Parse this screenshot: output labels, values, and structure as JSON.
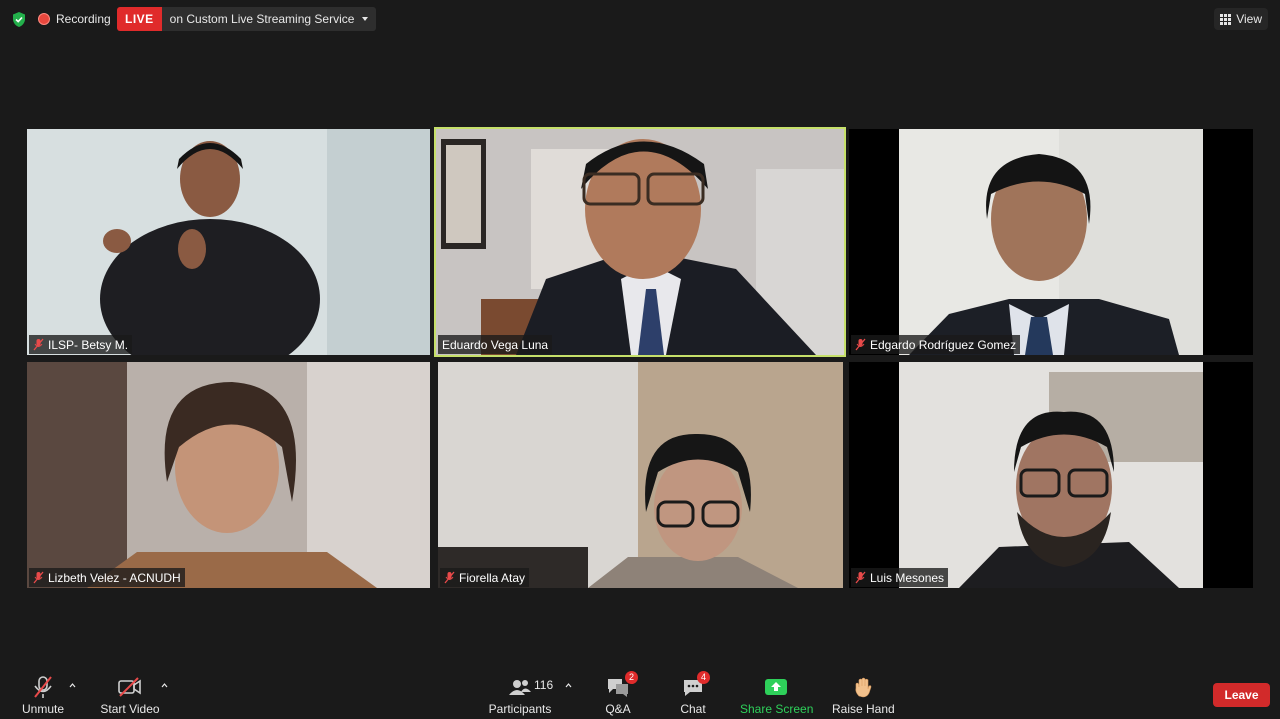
{
  "topbar": {
    "recording_label": "Recording",
    "live_label": "LIVE",
    "stream_target": "on Custom Live Streaming Service",
    "view_label": "View"
  },
  "participants": [
    {
      "name": "ILSP- Betsy M.",
      "muted": true,
      "active": false
    },
    {
      "name": "Eduardo Vega Luna",
      "muted": false,
      "active": true
    },
    {
      "name": "Edgardo Rodríguez Gomez",
      "muted": true,
      "active": false
    },
    {
      "name": "Lizbeth Velez - ACNUDH",
      "muted": true,
      "active": false
    },
    {
      "name": "Fiorella Atay",
      "muted": true,
      "active": false
    },
    {
      "name": "Luis Mesones",
      "muted": true,
      "active": false
    }
  ],
  "toolbar": {
    "unmute_label": "Unmute",
    "start_video_label": "Start Video",
    "participants_label": "Participants",
    "participants_count": "116",
    "qa_label": "Q&A",
    "qa_badge": "2",
    "chat_label": "Chat",
    "chat_badge": "4",
    "share_screen_label": "Share Screen",
    "raise_hand_label": "Raise Hand",
    "leave_label": "Leave"
  },
  "colors": {
    "background": "#1a1a1a",
    "live_red": "#e02b2b",
    "active_speaker_border": "#c6e06a",
    "share_green": "#2ed05a",
    "leave_red": "#d22a2a"
  },
  "icons": [
    "shield-icon",
    "record-icon",
    "grid-icon",
    "mic-muted-icon",
    "video-off-icon",
    "participants-icon",
    "qa-icon",
    "chat-icon",
    "share-screen-icon",
    "raise-hand-icon"
  ]
}
